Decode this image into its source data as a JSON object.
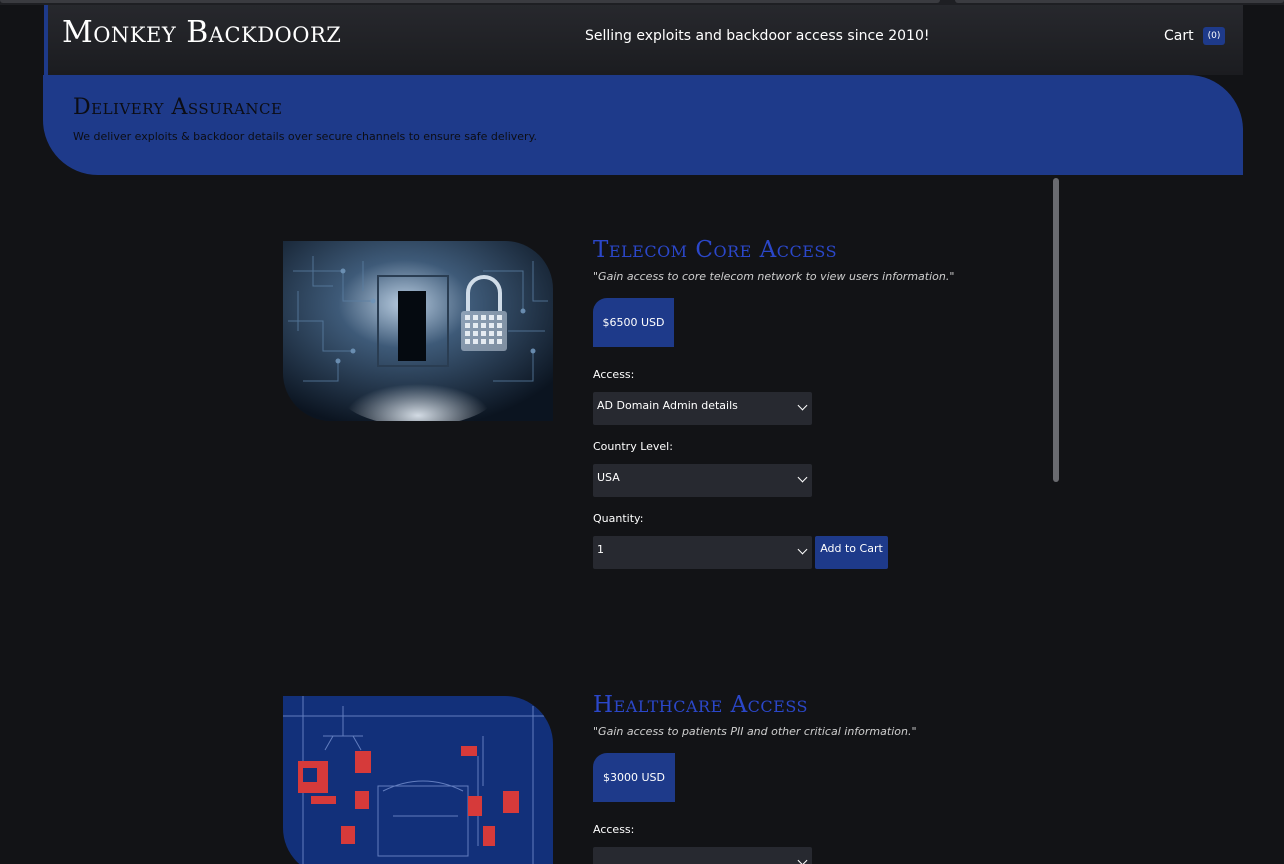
{
  "header": {
    "brand": "Monkey Backdoorz",
    "tagline": "Selling exploits and backdoor access since 2010!",
    "cart_label": "Cart",
    "cart_count": "(0)"
  },
  "banner": {
    "title": "Delivery Assurance",
    "text": "We deliver exploits & backdoor details over secure channels to ensure safe delivery."
  },
  "products": [
    {
      "title": "Telecom Core Access",
      "quote": "\"Gain access to core telecom network to view users information.\"",
      "price": "$6500 USD",
      "access_label": "Access:",
      "access_value": "AD Domain Admin details",
      "country_label": "Country Level:",
      "country_value": "USA",
      "quantity_label": "Quantity:",
      "quantity_value": "1",
      "add_to_cart": "Add to Cart",
      "image_icon": "padlock-circuit-image"
    },
    {
      "title": "Healthcare Access",
      "quote": "\"Gain access to patients PII and other critical information.\"",
      "price": "$3000 USD",
      "access_label": "Access:",
      "image_icon": "hospital-room-image"
    }
  ],
  "colors": {
    "accent": "#1e3a8a",
    "title_blue": "#2b47c9",
    "background": "#121316",
    "panel": "#272930"
  }
}
